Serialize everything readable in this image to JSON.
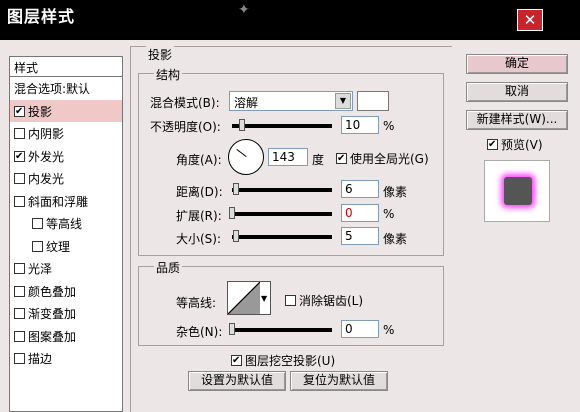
{
  "window": {
    "title": "图层样式"
  },
  "styles_list": {
    "header": "样式",
    "items": [
      {
        "label": "混合选项:默认",
        "checkbox": false,
        "checked": false,
        "indent": false,
        "selected": false
      },
      {
        "label": "投影",
        "checkbox": true,
        "checked": true,
        "indent": false,
        "selected": true
      },
      {
        "label": "内阴影",
        "checkbox": true,
        "checked": false,
        "indent": false,
        "selected": false
      },
      {
        "label": "外发光",
        "checkbox": true,
        "checked": true,
        "indent": false,
        "selected": false
      },
      {
        "label": "内发光",
        "checkbox": true,
        "checked": false,
        "indent": false,
        "selected": false
      },
      {
        "label": "斜面和浮雕",
        "checkbox": true,
        "checked": false,
        "indent": false,
        "selected": false
      },
      {
        "label": "等高线",
        "checkbox": true,
        "checked": false,
        "indent": true,
        "selected": false
      },
      {
        "label": "纹理",
        "checkbox": true,
        "checked": false,
        "indent": true,
        "selected": false
      },
      {
        "label": "光泽",
        "checkbox": true,
        "checked": false,
        "indent": false,
        "selected": false
      },
      {
        "label": "颜色叠加",
        "checkbox": true,
        "checked": false,
        "indent": false,
        "selected": false
      },
      {
        "label": "渐变叠加",
        "checkbox": true,
        "checked": false,
        "indent": false,
        "selected": false
      },
      {
        "label": "图案叠加",
        "checkbox": true,
        "checked": false,
        "indent": false,
        "selected": false
      },
      {
        "label": "描边",
        "checkbox": true,
        "checked": false,
        "indent": false,
        "selected": false
      }
    ]
  },
  "drop_shadow": {
    "section_title": "投影",
    "structure": {
      "title": "结构",
      "blend_mode_label": "混合模式(B):",
      "blend_mode_value": "溶解",
      "opacity_label": "不透明度(O):",
      "opacity_value": "10",
      "opacity_fraction": 0.1,
      "percent_sign": "%",
      "angle_label": "角度(A):",
      "angle_value": "143",
      "angle_unit": "度",
      "global_light_label": "使用全局光(G)",
      "global_light_checked": true,
      "distance_label": "距离(D):",
      "distance_value": "6",
      "distance_unit": "像素",
      "spread_label": "扩展(R):",
      "spread_value": "0",
      "size_label": "大小(S):",
      "size_value": "5",
      "size_unit": "像素"
    },
    "quality": {
      "title": "品质",
      "contour_label": "等高线:",
      "anti_alias_label": "消除锯齿(L)",
      "anti_alias_checked": false,
      "noise_label": "杂色(N):",
      "noise_value": "0",
      "percent_sign": "%"
    },
    "knockout_label": "图层挖空投影(U)",
    "knockout_checked": true,
    "make_default_label": "设置为默认值",
    "reset_default_label": "复位为默认值"
  },
  "right_panel": {
    "ok_label": "确定",
    "cancel_label": "取消",
    "new_style_label": "新建样式(W)...",
    "preview_label": "预览(V)",
    "preview_checked": true
  },
  "colors": {
    "shadow_swatch": "#ffffff",
    "preview_fill": "#555555",
    "preview_glow": "#ff40ff",
    "spread_value_color": "#d00000"
  }
}
